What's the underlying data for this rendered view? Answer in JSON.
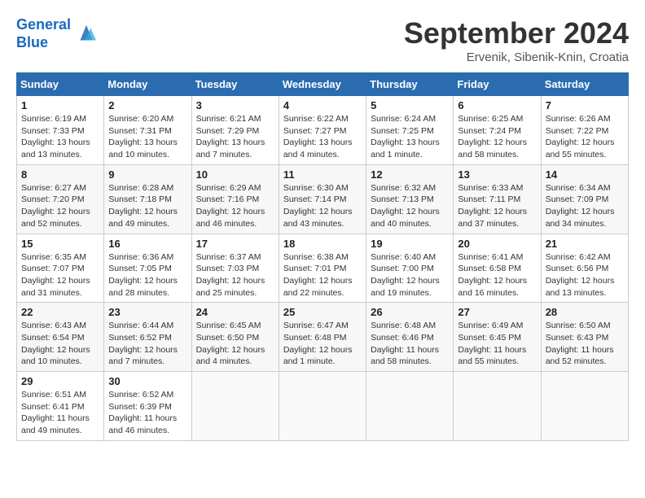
{
  "header": {
    "logo_line1": "General",
    "logo_line2": "Blue",
    "month": "September 2024",
    "location": "Ervenik, Sibenik-Knin, Croatia"
  },
  "days_of_week": [
    "Sunday",
    "Monday",
    "Tuesday",
    "Wednesday",
    "Thursday",
    "Friday",
    "Saturday"
  ],
  "weeks": [
    [
      {
        "day": "1",
        "info": "Sunrise: 6:19 AM\nSunset: 7:33 PM\nDaylight: 13 hours\nand 13 minutes."
      },
      {
        "day": "2",
        "info": "Sunrise: 6:20 AM\nSunset: 7:31 PM\nDaylight: 13 hours\nand 10 minutes."
      },
      {
        "day": "3",
        "info": "Sunrise: 6:21 AM\nSunset: 7:29 PM\nDaylight: 13 hours\nand 7 minutes."
      },
      {
        "day": "4",
        "info": "Sunrise: 6:22 AM\nSunset: 7:27 PM\nDaylight: 13 hours\nand 4 minutes."
      },
      {
        "day": "5",
        "info": "Sunrise: 6:24 AM\nSunset: 7:25 PM\nDaylight: 13 hours\nand 1 minute."
      },
      {
        "day": "6",
        "info": "Sunrise: 6:25 AM\nSunset: 7:24 PM\nDaylight: 12 hours\nand 58 minutes."
      },
      {
        "day": "7",
        "info": "Sunrise: 6:26 AM\nSunset: 7:22 PM\nDaylight: 12 hours\nand 55 minutes."
      }
    ],
    [
      {
        "day": "8",
        "info": "Sunrise: 6:27 AM\nSunset: 7:20 PM\nDaylight: 12 hours\nand 52 minutes."
      },
      {
        "day": "9",
        "info": "Sunrise: 6:28 AM\nSunset: 7:18 PM\nDaylight: 12 hours\nand 49 minutes."
      },
      {
        "day": "10",
        "info": "Sunrise: 6:29 AM\nSunset: 7:16 PM\nDaylight: 12 hours\nand 46 minutes."
      },
      {
        "day": "11",
        "info": "Sunrise: 6:30 AM\nSunset: 7:14 PM\nDaylight: 12 hours\nand 43 minutes."
      },
      {
        "day": "12",
        "info": "Sunrise: 6:32 AM\nSunset: 7:13 PM\nDaylight: 12 hours\nand 40 minutes."
      },
      {
        "day": "13",
        "info": "Sunrise: 6:33 AM\nSunset: 7:11 PM\nDaylight: 12 hours\nand 37 minutes."
      },
      {
        "day": "14",
        "info": "Sunrise: 6:34 AM\nSunset: 7:09 PM\nDaylight: 12 hours\nand 34 minutes."
      }
    ],
    [
      {
        "day": "15",
        "info": "Sunrise: 6:35 AM\nSunset: 7:07 PM\nDaylight: 12 hours\nand 31 minutes."
      },
      {
        "day": "16",
        "info": "Sunrise: 6:36 AM\nSunset: 7:05 PM\nDaylight: 12 hours\nand 28 minutes."
      },
      {
        "day": "17",
        "info": "Sunrise: 6:37 AM\nSunset: 7:03 PM\nDaylight: 12 hours\nand 25 minutes."
      },
      {
        "day": "18",
        "info": "Sunrise: 6:38 AM\nSunset: 7:01 PM\nDaylight: 12 hours\nand 22 minutes."
      },
      {
        "day": "19",
        "info": "Sunrise: 6:40 AM\nSunset: 7:00 PM\nDaylight: 12 hours\nand 19 minutes."
      },
      {
        "day": "20",
        "info": "Sunrise: 6:41 AM\nSunset: 6:58 PM\nDaylight: 12 hours\nand 16 minutes."
      },
      {
        "day": "21",
        "info": "Sunrise: 6:42 AM\nSunset: 6:56 PM\nDaylight: 12 hours\nand 13 minutes."
      }
    ],
    [
      {
        "day": "22",
        "info": "Sunrise: 6:43 AM\nSunset: 6:54 PM\nDaylight: 12 hours\nand 10 minutes."
      },
      {
        "day": "23",
        "info": "Sunrise: 6:44 AM\nSunset: 6:52 PM\nDaylight: 12 hours\nand 7 minutes."
      },
      {
        "day": "24",
        "info": "Sunrise: 6:45 AM\nSunset: 6:50 PM\nDaylight: 12 hours\nand 4 minutes."
      },
      {
        "day": "25",
        "info": "Sunrise: 6:47 AM\nSunset: 6:48 PM\nDaylight: 12 hours\nand 1 minute."
      },
      {
        "day": "26",
        "info": "Sunrise: 6:48 AM\nSunset: 6:46 PM\nDaylight: 11 hours\nand 58 minutes."
      },
      {
        "day": "27",
        "info": "Sunrise: 6:49 AM\nSunset: 6:45 PM\nDaylight: 11 hours\nand 55 minutes."
      },
      {
        "day": "28",
        "info": "Sunrise: 6:50 AM\nSunset: 6:43 PM\nDaylight: 11 hours\nand 52 minutes."
      }
    ],
    [
      {
        "day": "29",
        "info": "Sunrise: 6:51 AM\nSunset: 6:41 PM\nDaylight: 11 hours\nand 49 minutes."
      },
      {
        "day": "30",
        "info": "Sunrise: 6:52 AM\nSunset: 6:39 PM\nDaylight: 11 hours\nand 46 minutes."
      },
      {
        "day": "",
        "info": ""
      },
      {
        "day": "",
        "info": ""
      },
      {
        "day": "",
        "info": ""
      },
      {
        "day": "",
        "info": ""
      },
      {
        "day": "",
        "info": ""
      }
    ]
  ]
}
